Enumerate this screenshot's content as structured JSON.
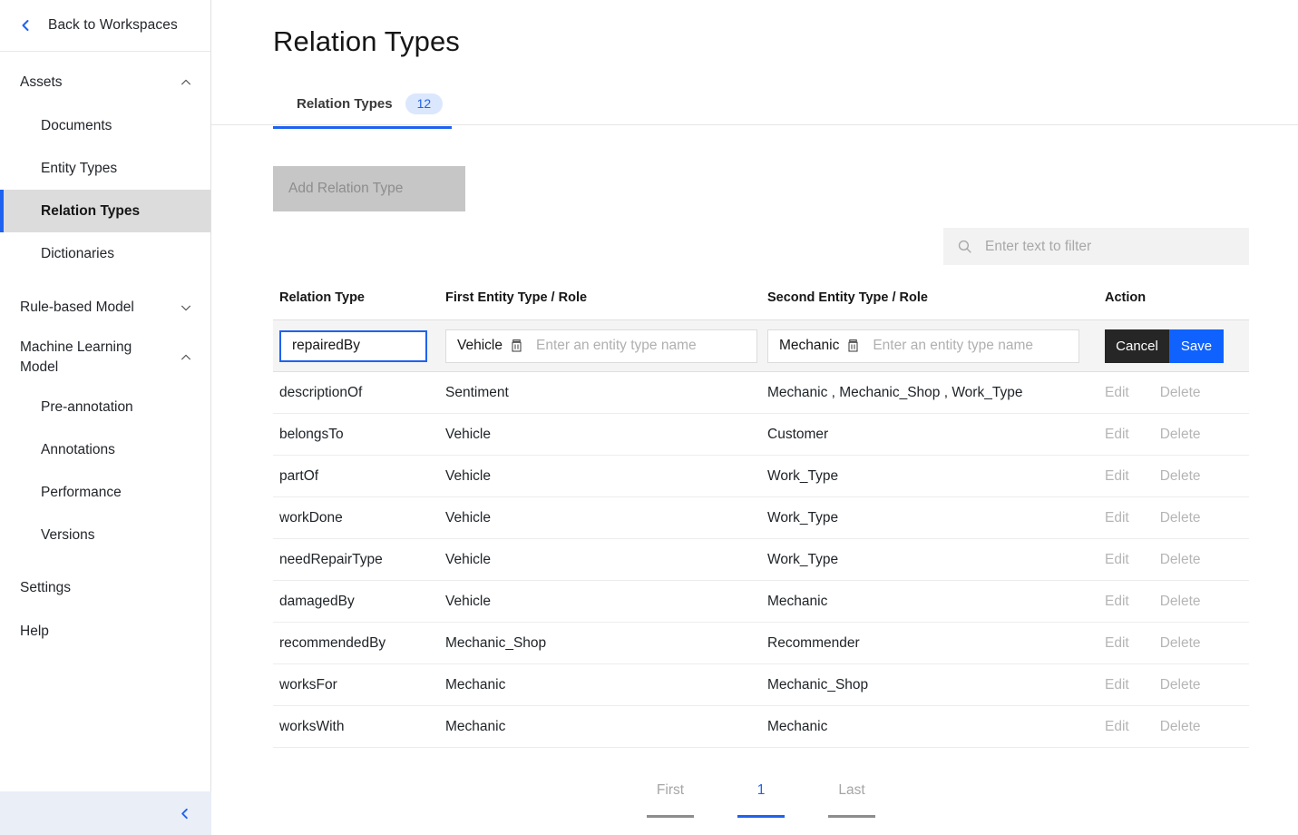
{
  "sidebar": {
    "back_label": "Back to Workspaces",
    "groups": [
      {
        "label": "Assets",
        "expanded": true,
        "items": [
          {
            "label": "Documents",
            "active": false
          },
          {
            "label": "Entity Types",
            "active": false
          },
          {
            "label": "Relation Types",
            "active": true
          },
          {
            "label": "Dictionaries",
            "active": false
          }
        ]
      },
      {
        "label": "Rule-based Model",
        "expanded": false,
        "items": []
      },
      {
        "label": "Machine Learning Model",
        "expanded": true,
        "items": [
          {
            "label": "Pre-annotation",
            "active": false
          },
          {
            "label": "Annotations",
            "active": false
          },
          {
            "label": "Performance",
            "active": false
          },
          {
            "label": "Versions",
            "active": false
          }
        ]
      }
    ],
    "leaf_items": [
      {
        "label": "Settings"
      },
      {
        "label": "Help"
      }
    ]
  },
  "header": {
    "title": "Relation Types"
  },
  "tabs": [
    {
      "label": "Relation Types",
      "badge": "12",
      "active": true
    }
  ],
  "toolbar": {
    "add_label": "Add Relation Type",
    "add_disabled": true
  },
  "filter": {
    "placeholder": "Enter text to filter",
    "value": ""
  },
  "table": {
    "columns": [
      "Relation Type",
      "First Entity Type / Role",
      "Second Entity Type / Role",
      "Action"
    ],
    "edit_row": {
      "name_value": "repairedBy",
      "first_entity_chip": "Vehicle",
      "first_entity_placeholder": "Enter an entity type name",
      "second_entity_chip": "Mechanic",
      "second_entity_placeholder": "Enter an entity type name",
      "cancel_label": "Cancel",
      "save_label": "Save"
    },
    "row_actions": {
      "edit_label": "Edit",
      "delete_label": "Delete"
    },
    "rows": [
      {
        "relation": "descriptionOf",
        "first": "Sentiment",
        "second": "Mechanic , Mechanic_Shop , Work_Type"
      },
      {
        "relation": "belongsTo",
        "first": "Vehicle",
        "second": "Customer"
      },
      {
        "relation": "partOf",
        "first": "Vehicle",
        "second": "Work_Type"
      },
      {
        "relation": "workDone",
        "first": "Vehicle",
        "second": "Work_Type"
      },
      {
        "relation": "needRepairType",
        "first": "Vehicle",
        "second": "Work_Type"
      },
      {
        "relation": "damagedBy",
        "first": "Vehicle",
        "second": "Mechanic"
      },
      {
        "relation": "recommendedBy",
        "first": "Mechanic_Shop",
        "second": "Recommender"
      },
      {
        "relation": "worksFor",
        "first": "Mechanic",
        "second": "Mechanic_Shop"
      },
      {
        "relation": "worksWith",
        "first": "Mechanic",
        "second": "Mechanic"
      }
    ]
  },
  "pagination": {
    "first_label": "First",
    "current_label": "1",
    "last_label": "Last"
  },
  "colors": {
    "accent_blue": "#1f62ef",
    "save_blue": "#0f62fe",
    "cancel_dark": "#262626",
    "active_nav_bg": "#dcdcdc",
    "badge_bg": "#dbe7fd",
    "disabled_btn_bg": "#c6c6c6"
  }
}
